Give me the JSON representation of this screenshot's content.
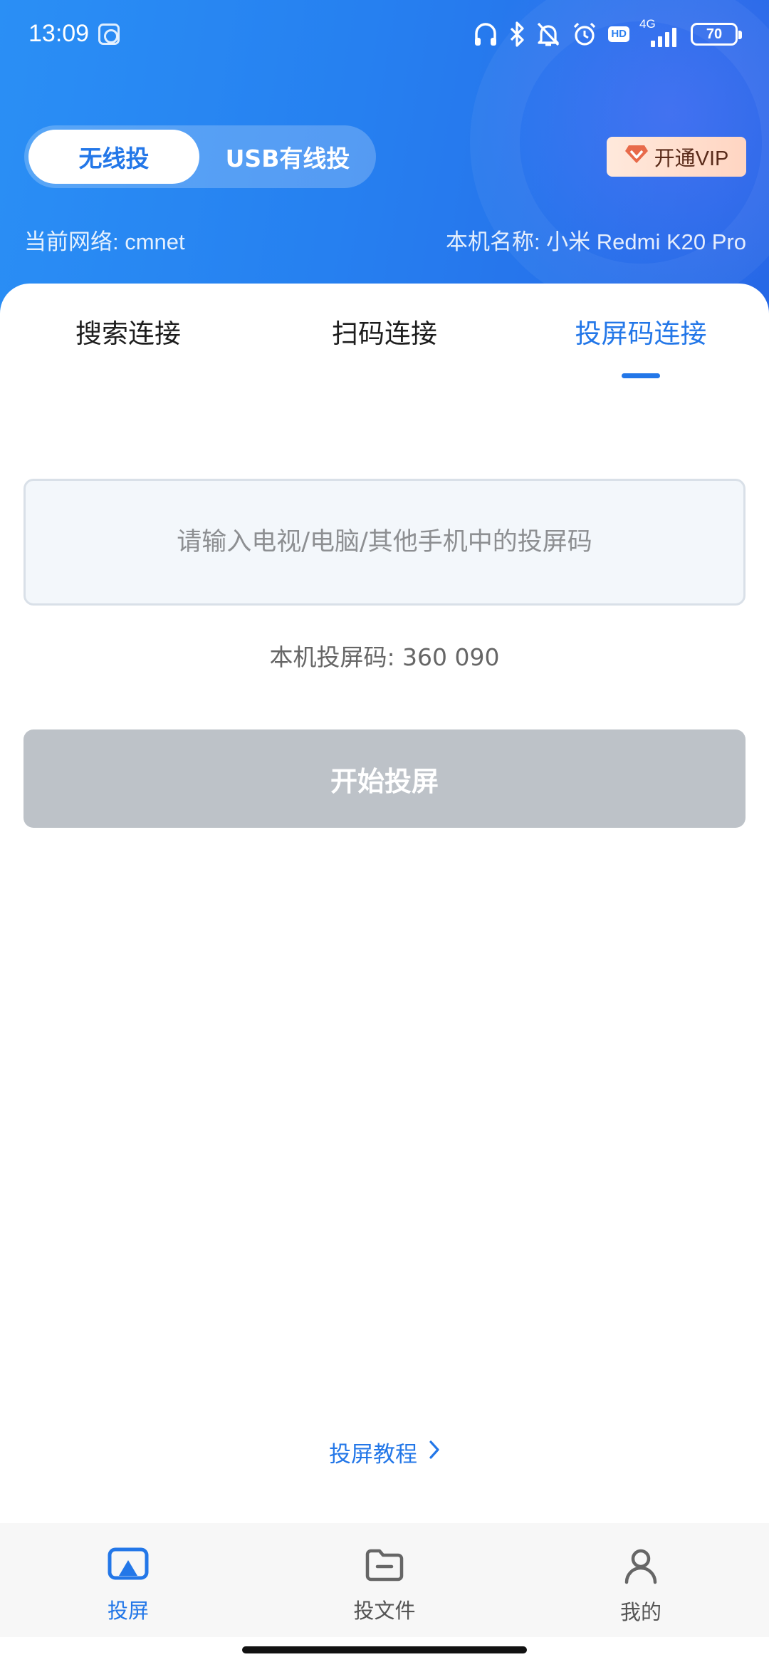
{
  "status_bar": {
    "time": "13:09",
    "network_type": "4G",
    "hd_label": "HD",
    "battery_level": "70"
  },
  "mode_toggle": {
    "active_label": "无线投",
    "inactive_label": "USB有线投"
  },
  "vip_button": {
    "label": "开通VIP"
  },
  "network_info": {
    "current_network": "当前网络: cmnet",
    "device_name": "本机名称: 小米 Redmi K20 Pro"
  },
  "tabs": [
    {
      "label": "搜索连接"
    },
    {
      "label": "扫码连接"
    },
    {
      "label": "投屏码连接"
    }
  ],
  "selected_tab": "投屏码连接",
  "code_input": {
    "value": "",
    "placeholder": "请输入电视/电脑/其他手机中的投屏码"
  },
  "local_code": "本机投屏码: 360 090",
  "start_button": {
    "label": "开始投屏"
  },
  "tutorial_link": {
    "label": "投屏教程"
  },
  "bottom_nav": {
    "items": [
      {
        "label": "投屏",
        "icon": "cast-screen-icon"
      },
      {
        "label": "投文件",
        "icon": "folder-icon"
      },
      {
        "label": "我的",
        "icon": "profile-icon"
      }
    ]
  },
  "colors": {
    "accent": "#2377e8",
    "header_gradient_start": "#2a8ff5",
    "header_gradient_end": "#2567e6",
    "disabled_button": "#bdc2c8",
    "vip_bg": "#ffd9c8"
  }
}
